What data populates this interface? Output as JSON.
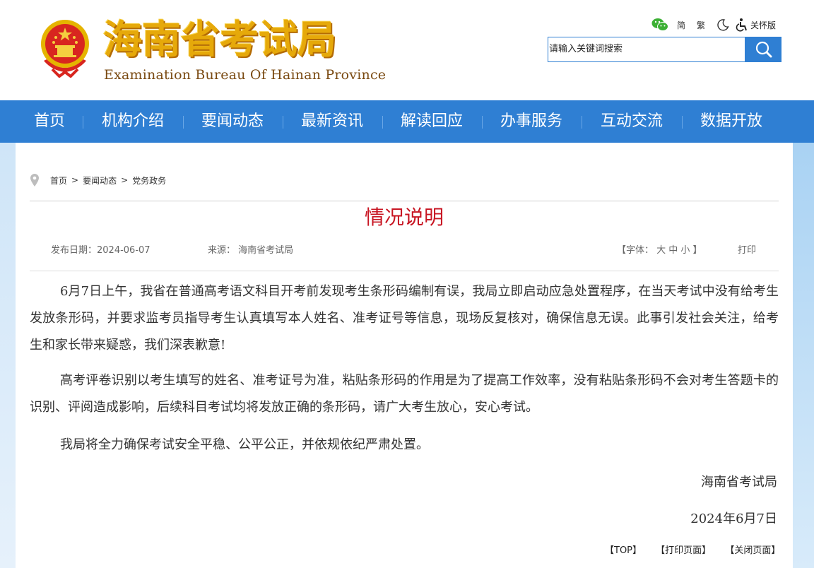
{
  "header": {
    "title_cn": "海南省考试局",
    "title_en": "Examination Bureau Of Hainan Province",
    "tools": {
      "simplified": "简",
      "traditional": "繁",
      "care_mode": "关怀版"
    },
    "search": {
      "placeholder": "请输入关键词搜索"
    }
  },
  "nav": {
    "items": [
      "首页",
      "机构介绍",
      "要闻动态",
      "最新资讯",
      "解读回应",
      "办事服务",
      "互动交流",
      "数据开放"
    ]
  },
  "breadcrumb": {
    "items": [
      "首页",
      "要闻动态",
      "党务政务"
    ],
    "separator": ">"
  },
  "article": {
    "title": "情况说明",
    "publish_date": "发布日期：2024-06-07",
    "source": "来源：  海南省考试局",
    "font_size": "【字体：  大   中   小  】",
    "print": "打印",
    "paragraphs": [
      "6月7日上午，我省在普通高考语文科目开考前发现考生条形码编制有误，我局立即启动应急处置程序，在当天考试中没有给考生发放条形码，并要求监考员指导考生认真填写本人姓名、准考证号等信息，现场反复核对，确保信息无误。此事引发社会关注，给考生和家长带来疑惑，我们深表歉意!",
      "高考评卷识别以考生填写的姓名、准考证号为准，粘贴条形码的作用是为了提高工作效率，没有粘贴条形码不会对考生答题卡的识别、评阅造成影响，后续科目考试均将发放正确的条形码，请广大考生放心，安心考试。",
      "我局将全力确保考试安全平稳、公平公正，并依规依纪严肃处置。"
    ],
    "signature": "海南省考试局",
    "date": "2024年6月7日"
  },
  "footer": {
    "top": "【TOP】",
    "print_page": "【打印页面】",
    "close_page": "【关闭页面】"
  },
  "colors": {
    "primary_blue": "#2f7fd3",
    "title_red": "#c81623",
    "logo_gold": "#e6a90a"
  }
}
